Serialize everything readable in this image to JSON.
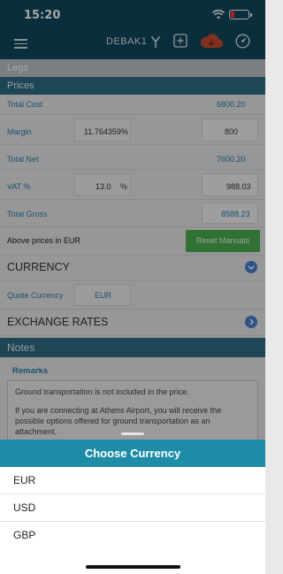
{
  "status_bar": {
    "time": "15:20"
  },
  "header": {
    "user": "DEBAK1",
    "icons": [
      "menu-icon",
      "branch-icon",
      "add-icon",
      "cloud-sync-icon",
      "speedometer-icon"
    ]
  },
  "sections": {
    "legs": "Legs",
    "prices": "Prices",
    "notes": "Notes"
  },
  "prices": {
    "total_cost_label": "Total Cost",
    "total_cost_value": "6800.20",
    "margin_label": "Margin",
    "margin_percent": "11.764359%",
    "margin_value": "800",
    "total_net_label": "Total Net",
    "total_net_value": "7600.20",
    "vat_label": "VAT %",
    "vat_percent": "13.0",
    "vat_percent_sign": "%",
    "vat_value": "988.03",
    "total_gross_label": "Total Gross",
    "total_gross_value": "8588.23",
    "currency_note": "Above prices in EUR",
    "reset_button": "Reset Manuals"
  },
  "currency": {
    "title": "CURRENCY",
    "quote_label": "Quote Currency",
    "quote_value": "EUR"
  },
  "exchange": {
    "title": "EXCHANGE RATES"
  },
  "remarks": {
    "title": "Remarks",
    "line1": "Ground transportation is not included in the price.",
    "line2": "If you are connecting at Athens Airport, you will receive the possible options offered for ground transportation as an attachment."
  },
  "sheet": {
    "title": "Choose Currency",
    "options": [
      "EUR",
      "USD",
      "GBP"
    ]
  },
  "colors": {
    "header": "#10475b",
    "section_blue": "#2e6d84",
    "sheet_header": "#1e8ca7",
    "accent_green": "#4caf50"
  }
}
